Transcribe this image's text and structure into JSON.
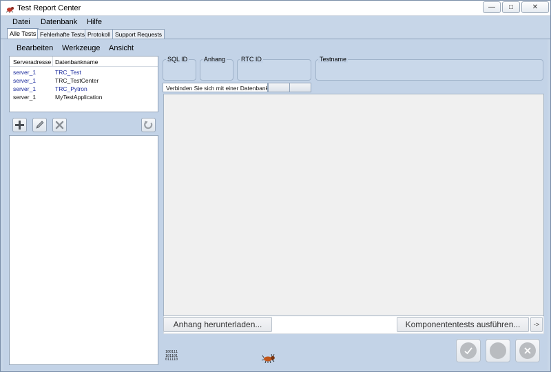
{
  "window": {
    "title": "Test Report Center",
    "controls": {
      "minimize": "—",
      "maximize": "□",
      "close": "✕"
    }
  },
  "menubar": {
    "items": [
      "Datei",
      "Datenbank",
      "Hilfe"
    ]
  },
  "tabs": [
    {
      "label": "Alle Tests",
      "active": true
    },
    {
      "label": "Fehlerhafte Tests",
      "active": false
    },
    {
      "label": "Protokoll",
      "active": false
    },
    {
      "label": "Support Requests",
      "active": false
    }
  ],
  "submenu": {
    "items": [
      "Bearbeiten",
      "Werkzeuge",
      "Ansicht"
    ]
  },
  "db_list": {
    "columns": [
      "Serveradresse",
      "Datenbankname"
    ],
    "rows": [
      {
        "server": "server_1",
        "name": "TRC_Test",
        "server_color": "#1a2a9c",
        "name_color": "#1a2a9c"
      },
      {
        "server": "server_1",
        "name": "TRC_TestCenter",
        "server_color": "#1a2a9c",
        "name_color": "#000000"
      },
      {
        "server": "server_1",
        "name": "TRC_Pytron",
        "server_color": "#1a2a9c",
        "name_color": "#1a2a9c"
      },
      {
        "server": "server_1",
        "name": "MyTestApplication",
        "server_color": "#000000",
        "name_color": "#000000"
      }
    ]
  },
  "toolbar": {
    "icons": [
      "plus-icon",
      "pencil-icon",
      "x-icon",
      "refresh-icon"
    ]
  },
  "fields": {
    "sql_id": "SQL ID",
    "anhang": "Anhang",
    "rtc_id": "RTC ID",
    "testname": "Testname"
  },
  "connect": {
    "message": "Verbinden Sie sich mit einer Datenbank."
  },
  "actions": {
    "download": "Anhang herunterladen...",
    "run": "Komponententests ausführen...",
    "more": "->"
  },
  "binary": [
    "100111",
    "101101",
    "011110"
  ],
  "status_buttons": [
    "check-icon",
    "circle-icon",
    "cancel-icon"
  ],
  "colors": {
    "background": "#c3d3e7",
    "window_frame": "#c7d6e8",
    "link_blue": "#1a2a9c"
  }
}
